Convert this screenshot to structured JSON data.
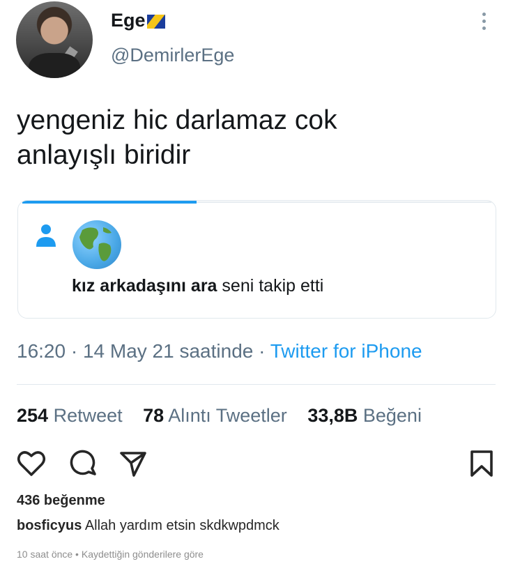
{
  "tweet": {
    "display_name": "Ege",
    "handle": "@DemirlerEge",
    "text_line1": "yengeniz hic darlamaz cok",
    "text_line2": "anlayışlı biridir",
    "quote": {
      "bold_text": "kız arkadaşını ara",
      "rest_text": " seni takip etti"
    },
    "time": "16:20 · 14 May 21 saatinde · ",
    "source": "Twitter for iPhone",
    "retweets": "254",
    "retweets_label": " Retweet",
    "quotes": "78",
    "quotes_label": " Alıntı Tweetler",
    "likes": "33,8B",
    "likes_label": " Beğeni"
  },
  "instagram": {
    "likes_text": "436 beğenme",
    "comment_user": "bosficyus",
    "comment_text": " Allah yardım etsin skdkwpdmck",
    "time_text": "10 saat önce • Kaydettiğin gönderilere göre"
  },
  "icons": {
    "heart": "heart-icon",
    "comment": "comment-icon",
    "share": "share-icon",
    "save": "bookmark-icon"
  },
  "colors": {
    "tweet_blue": "#1d9bf0",
    "muted": "#5b7083"
  }
}
